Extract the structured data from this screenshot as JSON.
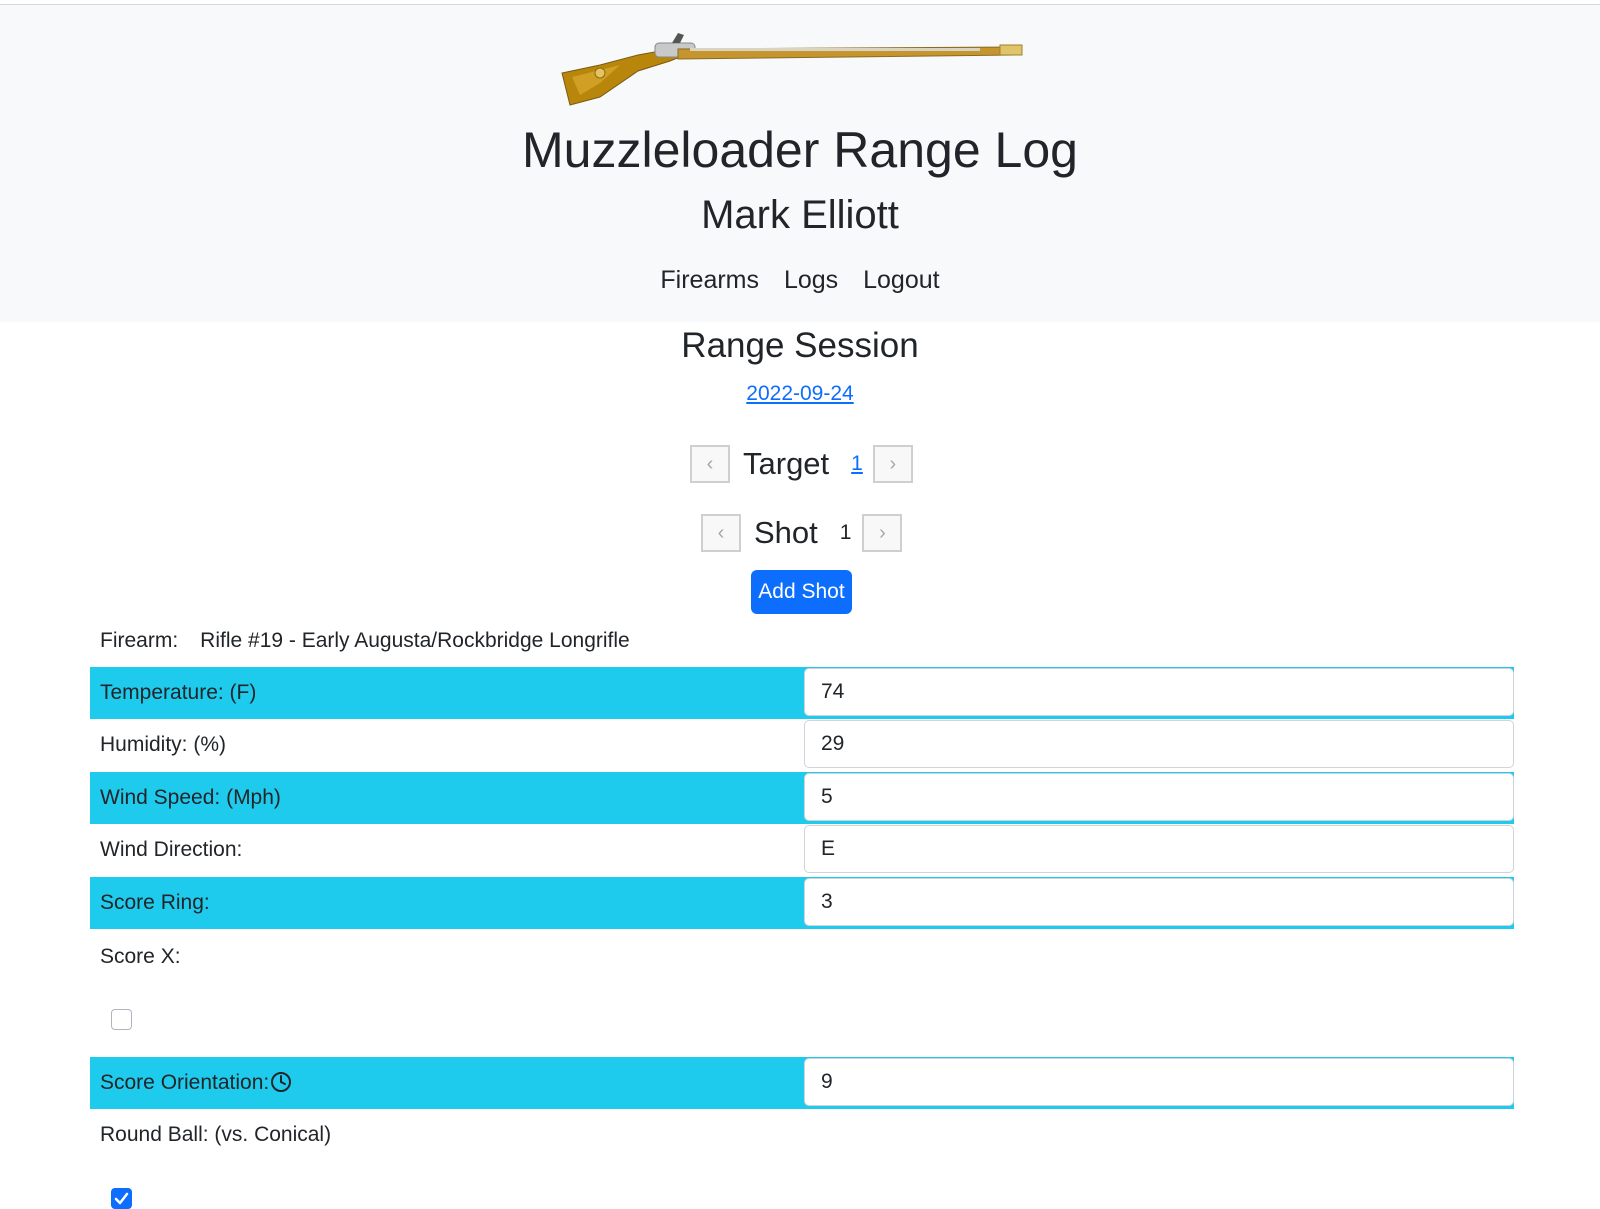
{
  "header": {
    "app_title": "Muzzleloader Range Log",
    "user_name": "Mark Elliott",
    "rifle_image": "flintlock-longrifle-image",
    "nav": [
      "Firearms",
      "Logs",
      "Logout"
    ]
  },
  "session": {
    "title": "Range Session",
    "date": "2022-09-24"
  },
  "target_pager": {
    "label": "Target",
    "value": "1",
    "prev_icon": "chevron-left-icon",
    "next_icon": "chevron-right-icon"
  },
  "shot_pager": {
    "label": "Shot",
    "value": "1",
    "prev_icon": "chevron-left-icon",
    "next_icon": "chevron-right-icon"
  },
  "add_shot_label": "Add Shot",
  "firearm": {
    "label": "Firearm:",
    "value": "Rifle #19 - Early Augusta/Rockbridge Longrifle"
  },
  "fields": {
    "temperature": {
      "label": "Temperature: (F)",
      "value": "74"
    },
    "humidity": {
      "label": "Humidity: (%)",
      "value": "29"
    },
    "wind_speed": {
      "label": "Wind Speed: (Mph)",
      "value": "5"
    },
    "wind_direction": {
      "label": "Wind Direction:",
      "value": "E"
    },
    "score_ring": {
      "label": "Score Ring:",
      "value": "3"
    },
    "score_x": {
      "label": "Score X:",
      "checked": false
    },
    "score_orientation": {
      "label": "Score Orientation:",
      "value": "9",
      "icon": "clock-icon"
    },
    "round_ball": {
      "label": "Round Ball: (vs. Conical)",
      "checked": true
    }
  },
  "colors": {
    "accent_cyan": "#1ecbed",
    "primary_blue": "#0d6efd",
    "header_bg": "#f8f9fa"
  }
}
